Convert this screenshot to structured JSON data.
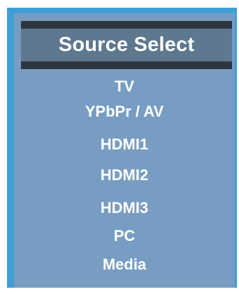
{
  "menu": {
    "title": "Source Select",
    "sources": [
      {
        "label": "TV"
      },
      {
        "label": "YPbPr / AV"
      },
      {
        "label": "HDMI1"
      },
      {
        "label": "HDMI2"
      },
      {
        "label": "HDMI3"
      },
      {
        "label": "PC"
      },
      {
        "label": "Media"
      }
    ]
  },
  "colors": {
    "frame_accent": "#3f9ed5",
    "panel_background": "#779dc2",
    "title_border": "#2f353f",
    "title_background": "#5d788f",
    "text": "#ffffff"
  }
}
